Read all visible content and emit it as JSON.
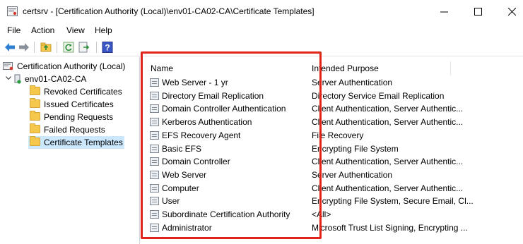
{
  "window": {
    "title": "certsrv - [Certification Authority (Local)\\env01-CA02-CA\\Certificate Templates]"
  },
  "menu": [
    "File",
    "Action",
    "View",
    "Help"
  ],
  "toolbar": {
    "icons": [
      "back-arrow-icon",
      "forward-arrow-icon",
      "up-folder-icon",
      "refresh-icon",
      "export-list-icon",
      "help-icon"
    ]
  },
  "tree": {
    "root": "Certification Authority (Local)",
    "ca": "env01-CA02-CA",
    "folders": [
      "Revoked Certificates",
      "Issued Certificates",
      "Pending Requests",
      "Failed Requests",
      "Certificate Templates"
    ],
    "selected_folder": "Certificate Templates"
  },
  "list": {
    "columns": [
      "Name",
      "Intended Purpose"
    ],
    "rows": [
      {
        "name": "Web Server - 1 yr",
        "purpose": "Server Authentication"
      },
      {
        "name": "Directory Email Replication",
        "purpose": "Directory Service Email Replication"
      },
      {
        "name": "Domain Controller Authentication",
        "purpose": "Client Authentication, Server Authentic..."
      },
      {
        "name": "Kerberos Authentication",
        "purpose": "Client Authentication, Server Authentic..."
      },
      {
        "name": "EFS Recovery Agent",
        "purpose": "File Recovery"
      },
      {
        "name": "Basic EFS",
        "purpose": "Encrypting File System"
      },
      {
        "name": "Domain Controller",
        "purpose": "Client Authentication, Server Authentic..."
      },
      {
        "name": "Web Server",
        "purpose": "Server Authentication"
      },
      {
        "name": "Computer",
        "purpose": "Client Authentication, Server Authentic..."
      },
      {
        "name": "User",
        "purpose": "Encrypting File System, Secure Email, Cl..."
      },
      {
        "name": "Subordinate Certification Authority",
        "purpose": "<All>"
      },
      {
        "name": "Administrator",
        "purpose": "Microsoft Trust List Signing, Encrypting ..."
      }
    ]
  },
  "annotation": {
    "color": "#e0241b"
  }
}
